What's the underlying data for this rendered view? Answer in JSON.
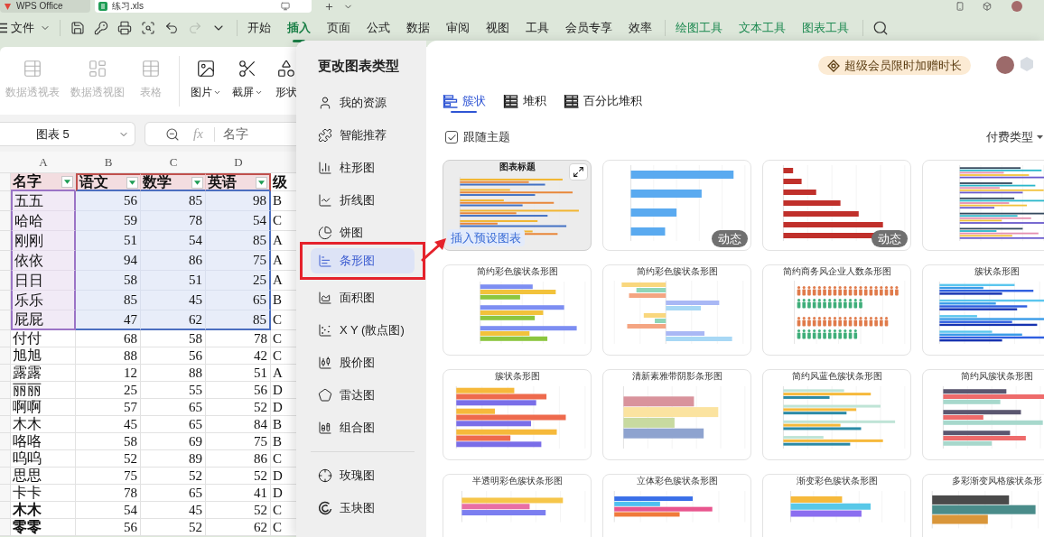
{
  "title_bar": {
    "tabs": [
      {
        "label": "WPS Office",
        "selected": false
      },
      {
        "label": "练习.xls",
        "selected": true
      }
    ]
  },
  "menu_bar": {
    "file_menu": "文件",
    "redo_disabled": true,
    "tabs": [
      {
        "label": "开始",
        "selected": false
      },
      {
        "label": "插入",
        "selected": true
      },
      {
        "label": "页面",
        "selected": false
      },
      {
        "label": "公式",
        "selected": false
      },
      {
        "label": "数据",
        "selected": false
      },
      {
        "label": "审阅",
        "selected": false
      },
      {
        "label": "视图",
        "selected": false
      },
      {
        "label": "工具",
        "selected": false
      },
      {
        "label": "会员专享",
        "selected": false
      },
      {
        "label": "效率",
        "selected": false
      }
    ],
    "context_tabs": [
      {
        "label": "绘图工具",
        "selected": false
      },
      {
        "label": "文本工具",
        "selected": false
      },
      {
        "label": "图表工具",
        "selected": false
      }
    ]
  },
  "ribbon": {
    "buttons": [
      {
        "label": "数据透视表",
        "disabled": true,
        "dropdown": false
      },
      {
        "label": "数据透视图",
        "disabled": true,
        "dropdown": false
      },
      {
        "label": "表格",
        "disabled": true,
        "dropdown": false
      },
      {
        "label": "图片",
        "disabled": false,
        "dropdown": true
      },
      {
        "label": "截屏",
        "disabled": false,
        "dropdown": true
      },
      {
        "label": "形状",
        "disabled": false,
        "dropdown": false
      }
    ]
  },
  "formula_bar": {
    "name_box": "图表 5",
    "function_label": "fx",
    "formula": "名字"
  },
  "sheet": {
    "columns": [
      "A",
      "B",
      "C",
      "D"
    ],
    "header": {
      "in_chart_range": true,
      "cells": [
        {
          "label": "名字",
          "filter": true
        },
        {
          "label": "语文",
          "filter": true
        },
        {
          "label": "数学",
          "filter": true
        },
        {
          "label": "英语",
          "filter": true
        },
        {
          "label": "级",
          "filter": false
        }
      ]
    },
    "rows": [
      {
        "cells": [
          "五五",
          "56",
          "85",
          "98",
          "B"
        ],
        "in_chart_range": true,
        "bold": false
      },
      {
        "cells": [
          "哈哈",
          "59",
          "78",
          "54",
          "C"
        ],
        "in_chart_range": true,
        "bold": false
      },
      {
        "cells": [
          "刚刚",
          "51",
          "54",
          "85",
          "A"
        ],
        "in_chart_range": true,
        "bold": false
      },
      {
        "cells": [
          "依依",
          "94",
          "86",
          "75",
          "A"
        ],
        "in_chart_range": true,
        "bold": false
      },
      {
        "cells": [
          "日日",
          "58",
          "51",
          "25",
          "A"
        ],
        "in_chart_range": true,
        "bold": false
      },
      {
        "cells": [
          "乐乐",
          "85",
          "45",
          "65",
          "B"
        ],
        "in_chart_range": true,
        "bold": false
      },
      {
        "cells": [
          "屁屁",
          "47",
          "62",
          "85",
          "C"
        ],
        "in_chart_range": true,
        "bold": false
      },
      {
        "cells": [
          "付付",
          "68",
          "58",
          "78",
          "C"
        ],
        "in_chart_range": false,
        "bold": false
      },
      {
        "cells": [
          "旭旭",
          "88",
          "56",
          "42",
          "C"
        ],
        "in_chart_range": false,
        "bold": false
      },
      {
        "cells": [
          "露露",
          "12",
          "88",
          "51",
          "A"
        ],
        "in_chart_range": false,
        "bold": false
      },
      {
        "cells": [
          "丽丽",
          "25",
          "55",
          "56",
          "D"
        ],
        "in_chart_range": false,
        "bold": false
      },
      {
        "cells": [
          "啊啊",
          "57",
          "65",
          "52",
          "D"
        ],
        "in_chart_range": false,
        "bold": false
      },
      {
        "cells": [
          "木木",
          "45",
          "65",
          "84",
          "B"
        ],
        "in_chart_range": false,
        "bold": false
      },
      {
        "cells": [
          "咯咯",
          "58",
          "69",
          "75",
          "B"
        ],
        "in_chart_range": false,
        "bold": false
      },
      {
        "cells": [
          "呜呜",
          "52",
          "89",
          "86",
          "C"
        ],
        "in_chart_range": false,
        "bold": false
      },
      {
        "cells": [
          "思思",
          "75",
          "52",
          "52",
          "D"
        ],
        "in_chart_range": false,
        "bold": false
      },
      {
        "cells": [
          "卡卡",
          "78",
          "65",
          "41",
          "D"
        ],
        "in_chart_range": false,
        "bold": false
      },
      {
        "cells": [
          "木木",
          "54",
          "45",
          "52",
          "C"
        ],
        "in_chart_range": false,
        "bold": true
      },
      {
        "cells": [
          "零零",
          "56",
          "52",
          "62",
          "C"
        ],
        "in_chart_range": false,
        "bold": true
      }
    ]
  },
  "dialog": {
    "title": "更改图表类型",
    "categories": [
      {
        "label": "我的资源",
        "selected": false
      },
      {
        "label": "智能推荐",
        "selected": false
      },
      {
        "label": "柱形图",
        "selected": false
      },
      {
        "label": "折线图",
        "selected": false
      },
      {
        "label": "饼图",
        "selected": false
      },
      {
        "label": "条形图",
        "selected": true
      },
      {
        "label": "面积图",
        "selected": false
      },
      {
        "label": "X Y (散点图)",
        "selected": false
      },
      {
        "label": "股价图",
        "selected": false
      },
      {
        "label": "雷达图",
        "selected": false
      },
      {
        "label": "组合图",
        "selected": false
      }
    ],
    "more_categories": [
      {
        "label": "玫瑰图",
        "selected": false
      },
      {
        "label": "玉块图",
        "selected": false
      }
    ],
    "promo": "超级会员限时加赠时长",
    "subtypes": [
      {
        "label": "簇状",
        "selected": true
      },
      {
        "label": "堆积",
        "selected": false
      },
      {
        "label": "百分比堆积",
        "selected": false
      }
    ],
    "follow_theme": {
      "label": "跟随主题",
      "checked": true
    },
    "filter": "付费类型",
    "templates": [
      {
        "kind": "bars",
        "title": "图表标题",
        "selected": true,
        "action": "插入预设图表"
      },
      {
        "kind": "bars",
        "badge": "动态",
        "selected": false
      },
      {
        "kind": "bars",
        "badge": "动态",
        "selected": false
      },
      {
        "kind": "bars",
        "selected": false
      },
      {
        "kind": "bars",
        "title": "简约彩色簇状条形图",
        "selected": false
      },
      {
        "kind": "diverging",
        "title": "简约彩色簇状条形图",
        "selected": false
      },
      {
        "kind": "pictogram",
        "title": "简约商务风企业人数条形图",
        "selected": false
      },
      {
        "kind": "bars",
        "title": "簇状条形图",
        "selected": false
      },
      {
        "kind": "bars",
        "title": "簇状条形图",
        "selected": false
      },
      {
        "kind": "bars",
        "title": "清新素雅带阴影条形图",
        "selected": false
      },
      {
        "kind": "bars",
        "title": "简约风蓝色簇状条形图",
        "selected": false
      },
      {
        "kind": "bars",
        "title": "简约风簇状条形图",
        "selected": false
      },
      {
        "kind": "bars",
        "title": "半透明彩色簇状条形图",
        "selected": false
      },
      {
        "kind": "bars",
        "title": "立体彩色簇状条形图",
        "selected": false
      },
      {
        "kind": "bars",
        "title": "渐变彩色簇状条形图",
        "selected": false
      },
      {
        "kind": "bars",
        "title": "多彩渐变风格簇状条形",
        "selected": false
      }
    ]
  }
}
